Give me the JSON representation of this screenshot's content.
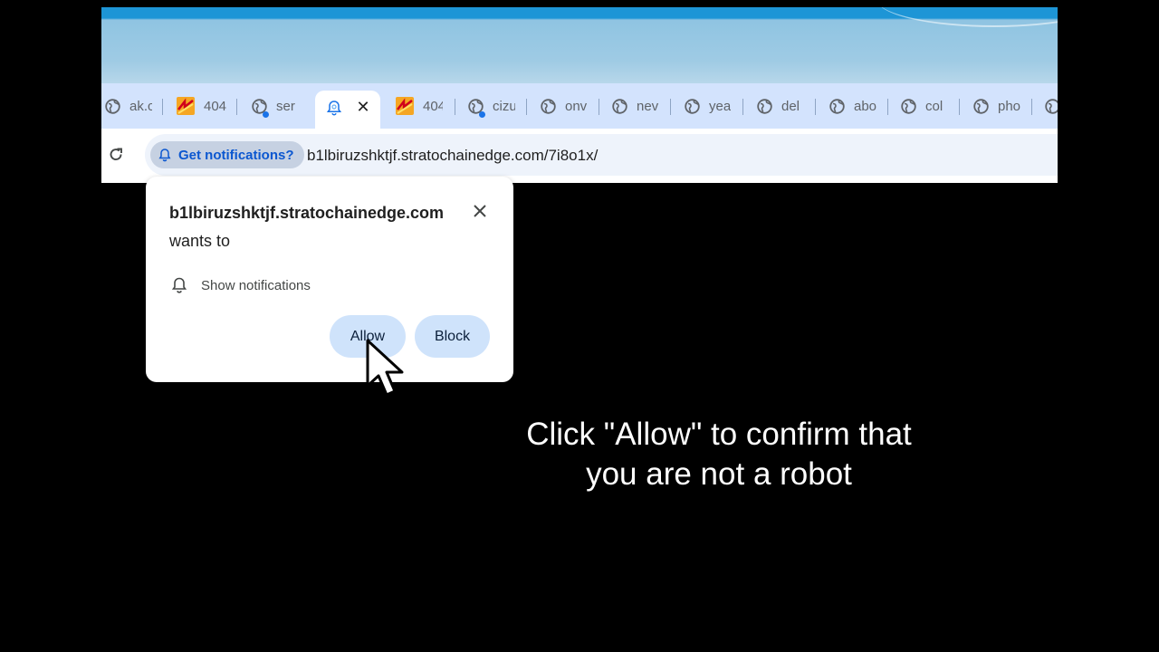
{
  "browser": {
    "tabs": [
      {
        "label": "ak.c",
        "icon": "globe-icon",
        "dot": false
      },
      {
        "label": "404",
        "icon": "error-404-icon",
        "dot": false
      },
      {
        "label": "ser",
        "icon": "globe-icon",
        "dot": true
      },
      {
        "label": "",
        "icon": "notification-bell-icon",
        "dot": false,
        "active": true
      },
      {
        "label": "404",
        "icon": "error-404-icon",
        "dot": false
      },
      {
        "label": "cizu",
        "icon": "globe-icon",
        "dot": true
      },
      {
        "label": "onv",
        "icon": "globe-icon",
        "dot": false
      },
      {
        "label": "nev",
        "icon": "globe-icon",
        "dot": false
      },
      {
        "label": "yea",
        "icon": "globe-icon",
        "dot": false
      },
      {
        "label": "del",
        "icon": "globe-icon",
        "dot": false
      },
      {
        "label": "abo",
        "icon": "globe-icon",
        "dot": false
      },
      {
        "label": "col",
        "icon": "globe-icon",
        "dot": false
      },
      {
        "label": "pho",
        "icon": "globe-icon",
        "dot": false
      }
    ],
    "address_bar": {
      "chip_label": "Get notifications?",
      "url": "b1lbiruzshktjf.stratochainedge.com/7i8o1x/"
    }
  },
  "permission_popup": {
    "host": "b1lbiruzshktjf.stratochainedge.com",
    "suffix": " wants to",
    "permission": "Show notifications",
    "allow_label": "Allow",
    "block_label": "Block"
  },
  "page": {
    "message_line1": "Click \"Allow\" to confirm that",
    "message_line2": "you are not a robot"
  },
  "colors": {
    "tabstrip": "#d3e3fd",
    "accent": "#0b57d0",
    "button": "#cfe3fb",
    "background": "#000000"
  }
}
